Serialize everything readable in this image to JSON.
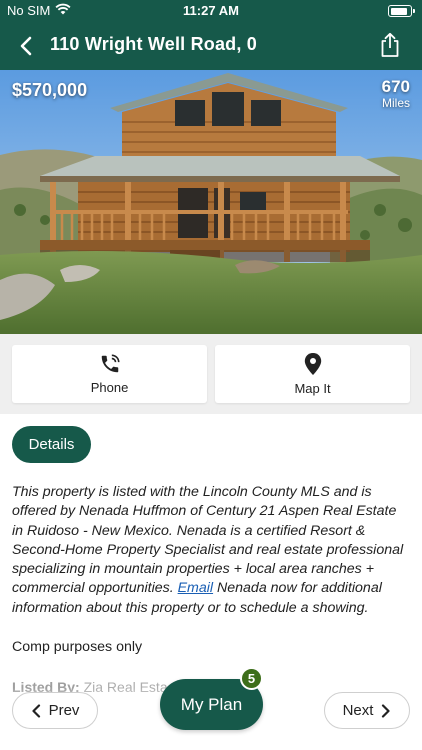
{
  "status_bar": {
    "carrier": "No SIM",
    "time": "11:27 AM",
    "battery_level": 0.9
  },
  "header": {
    "title": "110 Wright Well Road, 0",
    "back_icon": "chevron-left-icon",
    "share_icon": "share-icon"
  },
  "listing": {
    "price": "$570,000",
    "distance_value": "670",
    "distance_unit": "Miles"
  },
  "actions": {
    "phone_label": "Phone",
    "map_label": "Map It"
  },
  "details": {
    "tab_label": "Details",
    "description_before": "This property is listed with the Lincoln County MLS and is offered by Nenada Huffmon of Century 21 Aspen Real Estate in Ruidoso - New Mexico. Nenada is a certified Resort & Second-Home Property Specialist and real estate professional specializing in mountain properties + local area ranches + commercial opportunities. ",
    "email_link": "Email",
    "description_after": " Nenada now for additional information about this property or to schedule a showing.",
    "comp_note": "Comp purposes only",
    "listed_by_label": "Listed By:",
    "listed_by_value": "Zia Real Esta"
  },
  "bottom_nav": {
    "prev_label": "Prev",
    "plan_label": "My Plan",
    "plan_count": "5",
    "next_label": "Next"
  },
  "colors": {
    "brand": "#16594a",
    "badge": "#3d6e1a",
    "link": "#1a5fb4"
  }
}
